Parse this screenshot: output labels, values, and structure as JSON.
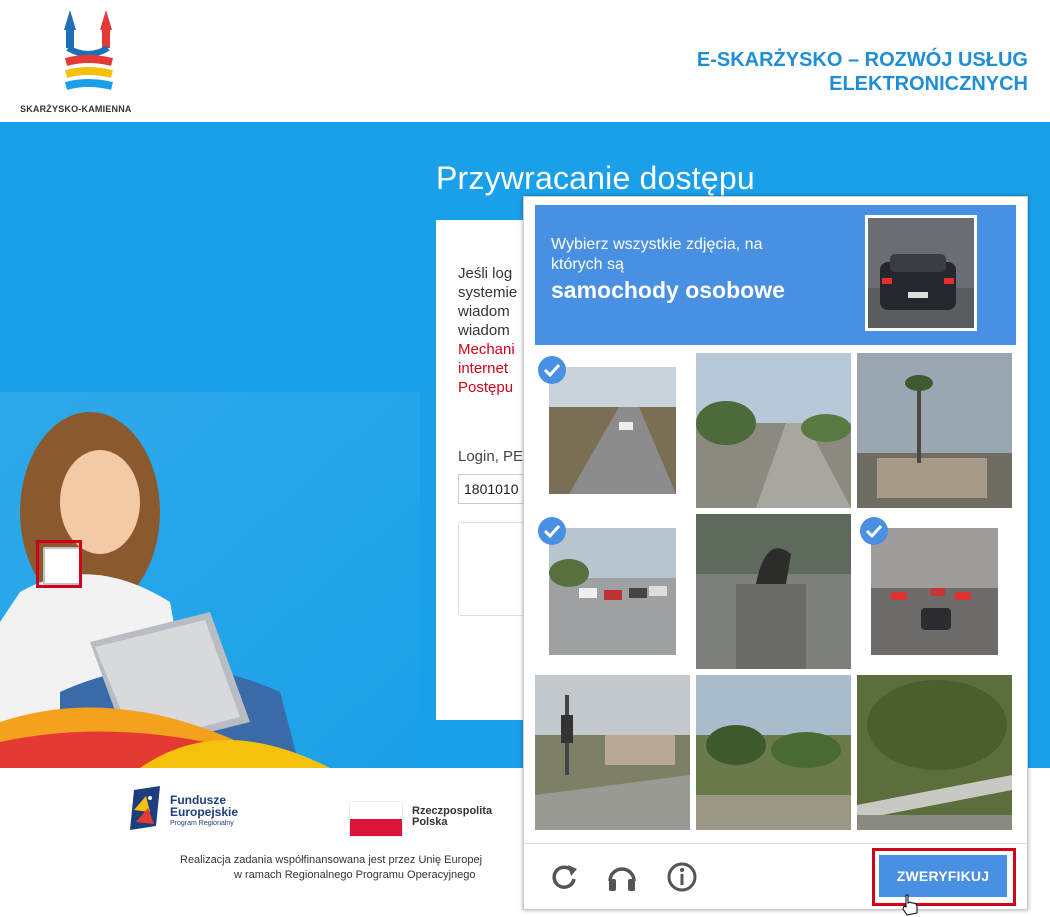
{
  "header": {
    "logo_text": "SKARŻYSKO-KAMIENNA",
    "title_line1": "E-SKARŻYSKO – ROZWÓJ USŁUG",
    "title_line2": "ELEKTRONICZNYCH"
  },
  "main": {
    "page_title": "Przywracanie dostępu",
    "intro_lines": [
      "Jeśli log",
      "systemie",
      "wiadom",
      "wiadom"
    ],
    "red_lines": [
      "Mechani",
      "internet",
      "Postępu"
    ],
    "login_label": "Login, PE",
    "login_value": "1801010"
  },
  "footer": {
    "fe_line1": "Fundusze",
    "fe_line2": "Europejskie",
    "fe_line3": "Program Regionalny",
    "rp_line1": "Rzeczpospolita",
    "rp_line2": "Polska",
    "line1": "Realizacja zadania współfinansowana jest przez Unię Europej",
    "line2": "w ramach Regionalnego Programu Operacyjnego"
  },
  "captcha": {
    "prompt_line1": "Wybierz wszystkie zdjęcia, na",
    "prompt_line2": "których są",
    "target": "samochody osobowe",
    "verify_label": "ZWERYFIKUJ",
    "tiles": [
      {
        "name": "road-highway",
        "selected": true
      },
      {
        "name": "palm-street",
        "selected": false
      },
      {
        "name": "palm-house",
        "selected": false
      },
      {
        "name": "traffic-intersection",
        "selected": true
      },
      {
        "name": "statue",
        "selected": false
      },
      {
        "name": "car-traffic-dusk",
        "selected": true
      },
      {
        "name": "traffic-light-houses",
        "selected": false
      },
      {
        "name": "palm-park",
        "selected": false
      },
      {
        "name": "guardrail-trees",
        "selected": false
      }
    ],
    "icons": [
      "reload-icon",
      "audio-icon",
      "info-icon"
    ]
  },
  "colors": {
    "hero_blue": "#1aa0e8",
    "captcha_blue": "#4a90e2",
    "highlight_red": "#d0021b",
    "title_blue": "#1e8fd6"
  }
}
